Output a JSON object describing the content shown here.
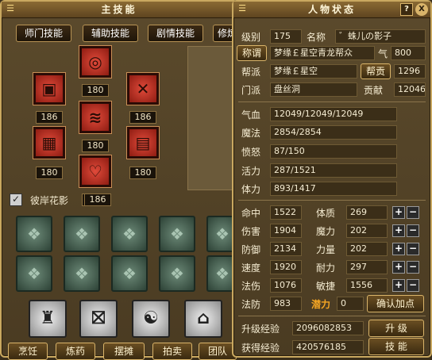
{
  "skill_window": {
    "title": "主技能",
    "tabs": [
      "师门技能",
      "辅助技能",
      "剧情技能",
      "修炼"
    ],
    "skill_levels": [
      "180",
      "186",
      "180",
      "186",
      "180",
      "180",
      "180",
      "180"
    ],
    "passive_label": "彼岸花影",
    "passive_level": "186",
    "bottom_buttons": [
      "烹饪",
      "炼药",
      "摆摊",
      "拍卖",
      "团队"
    ]
  },
  "status_window": {
    "title": "人物状态",
    "help_icon": "?",
    "close_icon": "X",
    "level_label": "级别",
    "level_value": "175",
    "name_label": "名称",
    "name_value": "゛蛛儿の影子",
    "title_button": "称谓",
    "title_value": "梦缘￡星空青龙帮众",
    "qi_label": "气",
    "qi_value": "800",
    "gang_label": "帮派",
    "gang_value": "梦缘￡星空",
    "gang_contrib_button": "帮贡",
    "gang_contrib_value": "1296",
    "school_label": "门派",
    "school_value": "盘丝洞",
    "contrib_label": "贡献",
    "contrib_value": "12046",
    "hp_label": "气血",
    "hp_value": "12049/12049/12049",
    "mp_label": "魔法",
    "mp_value": "2854/2854",
    "anger_label": "愤怒",
    "anger_value": "87/150",
    "vitality_label": "活力",
    "vitality_value": "287/1521",
    "stamina_label": "体力",
    "stamina_value": "893/1417",
    "stats_left": [
      {
        "label": "命中",
        "value": "1522"
      },
      {
        "label": "伤害",
        "value": "1904"
      },
      {
        "label": "防御",
        "value": "2134"
      },
      {
        "label": "速度",
        "value": "1920"
      },
      {
        "label": "法伤",
        "value": "1076"
      },
      {
        "label": "法防",
        "value": "983"
      }
    ],
    "stats_right": [
      {
        "label": "体质",
        "value": "269"
      },
      {
        "label": "魔力",
        "value": "202"
      },
      {
        "label": "力量",
        "value": "202"
      },
      {
        "label": "耐力",
        "value": "297"
      },
      {
        "label": "敏捷",
        "value": "1556"
      }
    ],
    "potential_label": "潜力",
    "potential_value": "0",
    "confirm_button": "确认加点",
    "upgrade_exp_label": "升级经验",
    "upgrade_exp_value": "2096082853",
    "upgrade_button": "升 级",
    "obtained_exp_label": "获得经验",
    "obtained_exp_value": "420576185",
    "skill_button": "技 能"
  }
}
